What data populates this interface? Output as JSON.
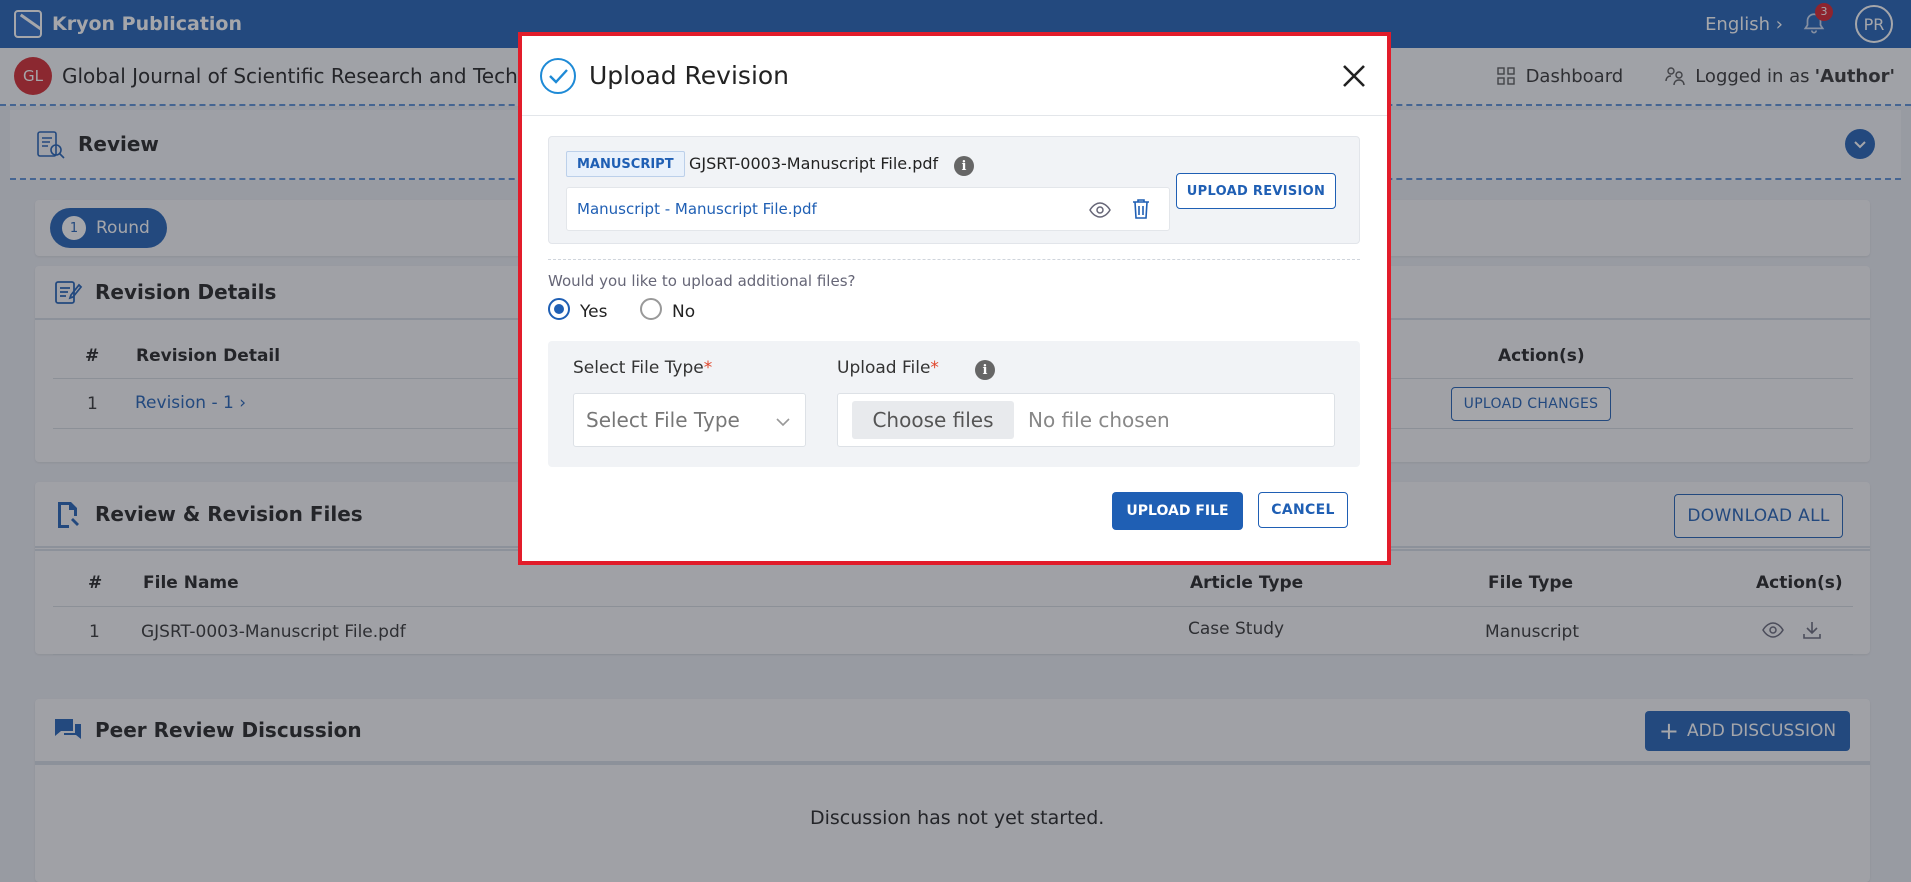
{
  "app": {
    "title": "Kryon Publication",
    "language": "English",
    "notification_count": "3",
    "avatar_initials": "PR"
  },
  "journal": {
    "badge": "GL",
    "name": "Global Journal of Scientific Research and Technology"
  },
  "nav": {
    "dashboard": "Dashboard",
    "logged_prefix": "Logged in as",
    "role": "'Author'"
  },
  "review": {
    "title": "Review",
    "round_number": "1",
    "round_label": "Round"
  },
  "revision_details": {
    "title": "Revision Details",
    "col_index": "#",
    "col_detail": "Revision Detail",
    "col_actions": "Action(s)",
    "rows": [
      {
        "index": "1",
        "detail": "Revision - 1",
        "action": "UPLOAD CHANGES"
      }
    ]
  },
  "files": {
    "title": "Review & Revision Files",
    "download_all": "DOWNLOAD ALL",
    "col_index": "#",
    "col_name": "File Name",
    "col_article": "Article Type",
    "col_type": "File Type",
    "col_actions": "Action(s)",
    "rows": [
      {
        "index": "1",
        "name": "GJSRT-0003-Manuscript File.pdf",
        "article": "Case Study",
        "type": "Manuscript"
      }
    ]
  },
  "discussion": {
    "title": "Peer Review Discussion",
    "add": "ADD DISCUSSION",
    "empty": "Discussion has not yet started."
  },
  "modal": {
    "title": "Upload Revision",
    "tag": "MANUSCRIPT",
    "file_name": "GJSRT-0003-Manuscript File.pdf",
    "file_link": "Manuscript - Manuscript File.pdf",
    "upload_revision": "UPLOAD REVISION",
    "question": "Would you like to upload additional files?",
    "yes": "Yes",
    "no": "No",
    "selected": "Yes",
    "file_type_label": "Select File Type",
    "file_type_placeholder": "Select File Type",
    "upload_file_label": "Upload File",
    "choose_files": "Choose files",
    "no_file": "No file chosen",
    "upload_file_btn": "UPLOAD FILE",
    "cancel_btn": "CANCEL"
  },
  "colors": {
    "primary": "#1f5fb4",
    "highlight": "#e21c2a",
    "badge": "#d3262e"
  }
}
